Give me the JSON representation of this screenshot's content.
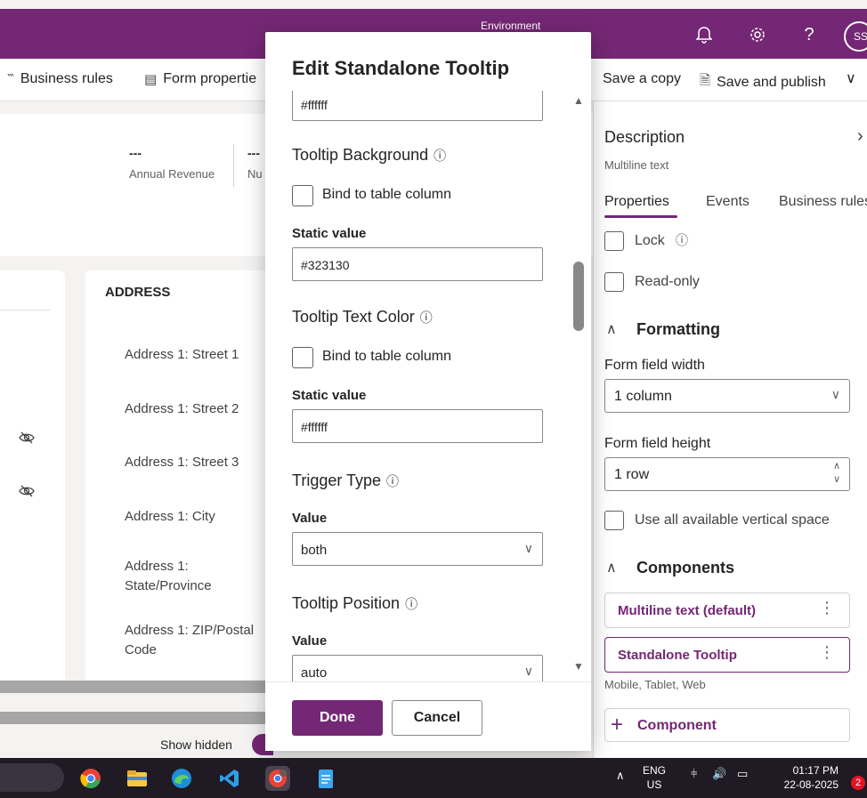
{
  "topbar": {
    "environment_label": "Environment",
    "avatar_initials": "SS"
  },
  "cmdbar": {
    "business_rules": "Business rules",
    "form_properties": "Form propertie",
    "save_copy": "Save a copy",
    "save_publish": "Save and publish"
  },
  "form_header": {
    "field1_value": "---",
    "field1_label": "Annual Revenue",
    "field2_value": "---",
    "field2_label": "Nu"
  },
  "address_card": {
    "title": "ADDRESS",
    "labels": [
      "Address 1: Street 1",
      "Address 1: Street 2",
      "Address 1: Street 3",
      "Address 1: City",
      "Address 1: State/Province",
      "Address 1: ZIP/Postal Code"
    ]
  },
  "canvas_footer": {
    "show_hidden": "Show hidden"
  },
  "modal": {
    "title": "Edit Standalone Tooltip",
    "top_input_value": "#ffffff",
    "bg_section": "Tooltip Background",
    "bg_bind_label": "Bind to table column",
    "bg_static_label": "Static value",
    "bg_static_value": "#323130",
    "text_color_section": "Tooltip Text Color",
    "text_color_bind_label": "Bind to table column",
    "text_color_static_label": "Static value",
    "text_color_static_value": "#ffffff",
    "trigger_section": "Trigger Type",
    "trigger_value_label": "Value",
    "trigger_value": "both",
    "position_section": "Tooltip Position",
    "position_value_label": "Value",
    "position_value": "auto",
    "done": "Done",
    "cancel": "Cancel"
  },
  "properties_panel": {
    "title": "Description",
    "subtitle": "Multiline text",
    "tabs": [
      "Properties",
      "Events",
      "Business rules"
    ],
    "lock_label": "Lock",
    "readonly_label": "Read-only",
    "formatting_heading": "Formatting",
    "width_label": "Form field width",
    "width_value": "1 column",
    "height_label": "Form field height",
    "height_value": "1 row",
    "vertical_space_label": "Use all available vertical space",
    "components_heading": "Components",
    "component_default": "Multiline text (default)",
    "component_tooltip": "Standalone Tooltip",
    "component_platforms": "Mobile, Tablet, Web",
    "add_component": "Component"
  },
  "taskbar": {
    "lang_line1": "ENG",
    "lang_line2": "US",
    "time": "01:17 PM",
    "date": "22-08-2025",
    "notification_count": "2"
  },
  "colors": {
    "brand": "#742774",
    "taskbar": "#1f1a24"
  }
}
